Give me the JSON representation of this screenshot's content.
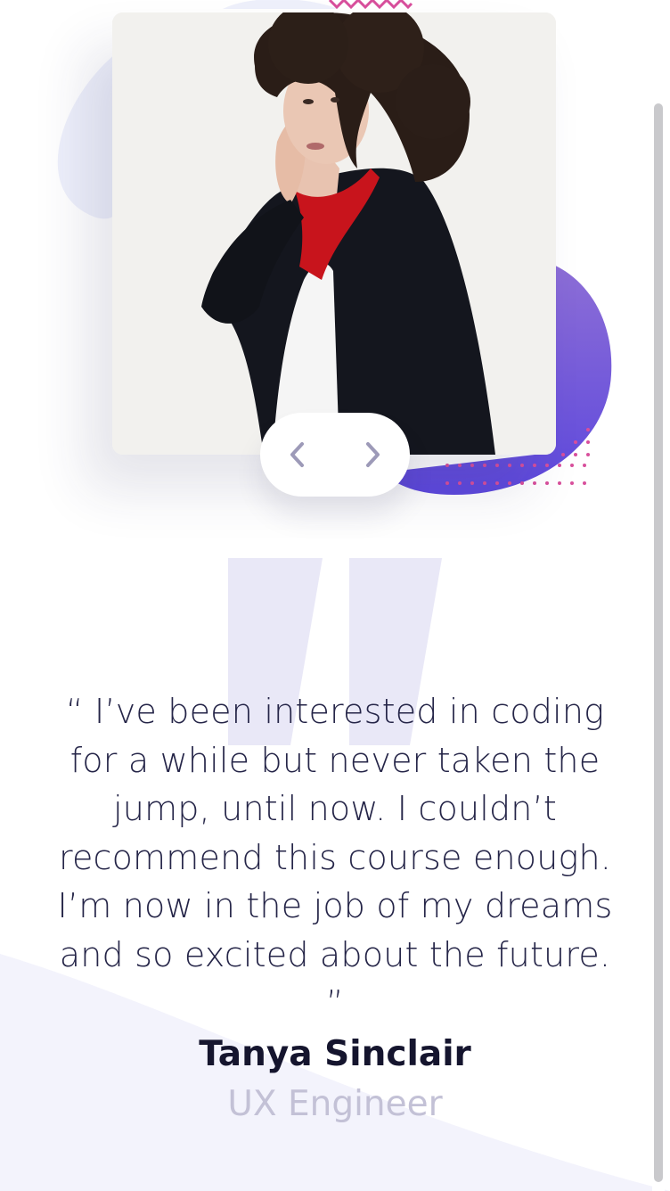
{
  "testimonial": {
    "quote": "“ I’ve been interested in coding for a while but never taken the jump, until now. I couldn’t recommend this course enough. I’m now in the job of my dreams and so excited about the future. ”",
    "author_name": "Tanya Sinclair",
    "author_role": "UX Engineer"
  },
  "navigation": {
    "prev_icon": "chevron-left-icon",
    "next_icon": "chevron-right-icon"
  },
  "colors": {
    "accent_purple": "#6a52e0",
    "accent_purple_light": "#8e6fd6",
    "pattern_pink": "#d84f9c",
    "text_dark": "#252548",
    "text_muted": "#c3c1d6",
    "bg_tint": "#f1f1fb"
  }
}
